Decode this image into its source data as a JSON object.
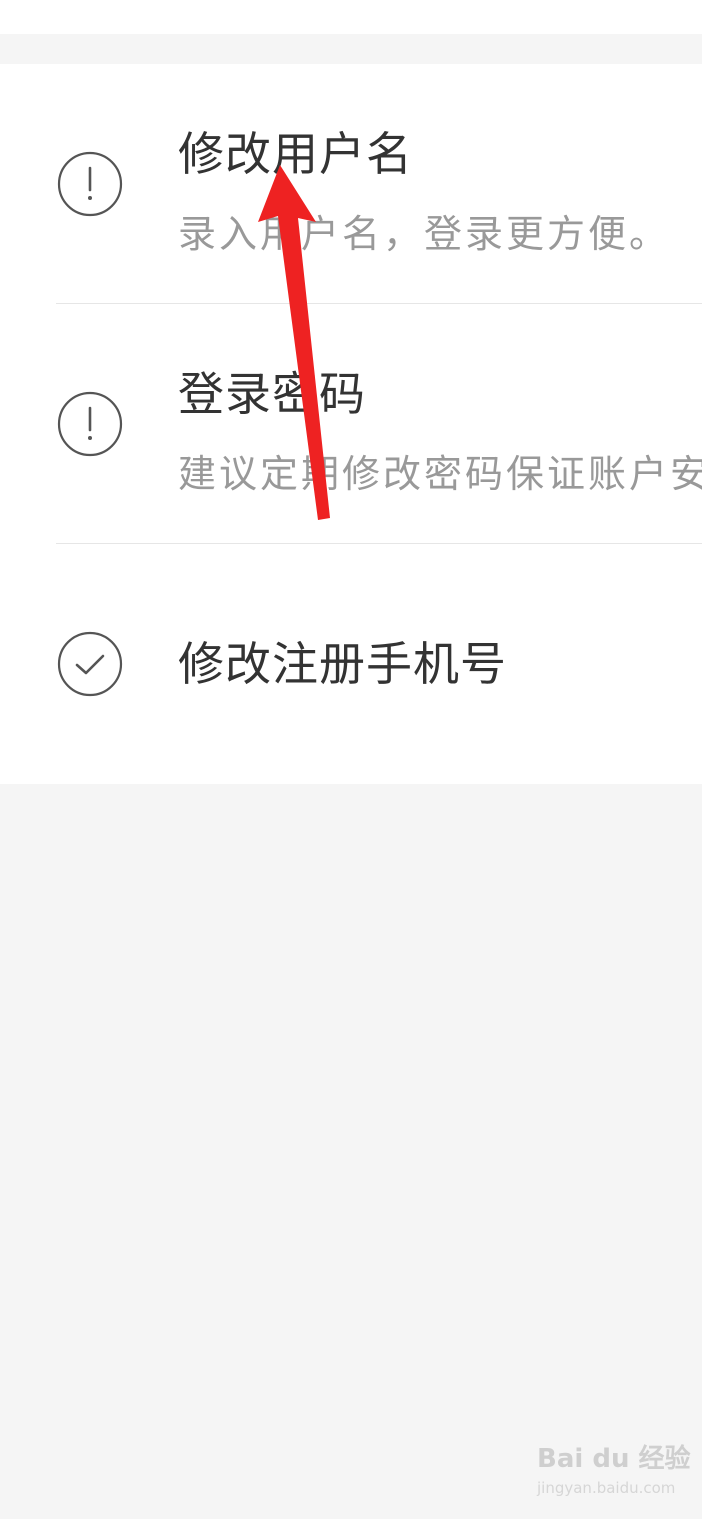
{
  "account_list": {
    "items": [
      {
        "icon": "exclamation-circle-icon",
        "title": "修改用户名",
        "subtitle": "录入用户名，登录更方便。",
        "status": "warning"
      },
      {
        "icon": "exclamation-circle-icon",
        "title": "登录密码",
        "subtitle": "建议定期修改密码保证账户安全",
        "status": "warning"
      },
      {
        "icon": "check-circle-icon",
        "title": "修改注册手机号",
        "status": "done"
      }
    ]
  },
  "annotation": {
    "color": "#ee2222",
    "icon": "red-arrow-icon"
  },
  "watermark": {
    "main": "Bai du 经验",
    "sub": "jingyan.baidu.com"
  },
  "colors": {
    "background": "#f5f5f5",
    "panel": "#ffffff",
    "title_text": "#333333",
    "subtitle_text": "#999999",
    "icon_stroke": "#555555"
  }
}
